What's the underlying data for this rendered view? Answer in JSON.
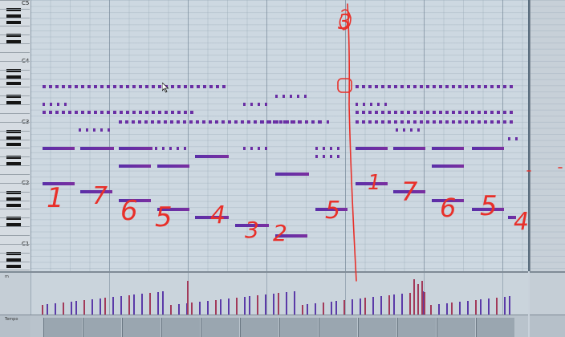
{
  "keyboard": {
    "octave_labels": [
      "C5",
      "C4",
      "C3",
      "C2",
      "C1"
    ]
  },
  "velocity_lane": {
    "label": "m"
  },
  "controller_lane": {
    "label": "Tempo"
  },
  "colors": {
    "note": "#6a2fa6",
    "velocity_bar": "#5b3aa8",
    "annotation_ink": "#e8302a",
    "grid_bg": "#cdd8e1"
  },
  "icons": [
    "mouse-pointer-icon"
  ],
  "annotations": {
    "scale_numbers": [
      "1",
      "7",
      "6",
      "5",
      "4",
      "3",
      "2",
      "5",
      "1",
      "7",
      "6",
      "5",
      "4"
    ],
    "marker_number": "3"
  }
}
